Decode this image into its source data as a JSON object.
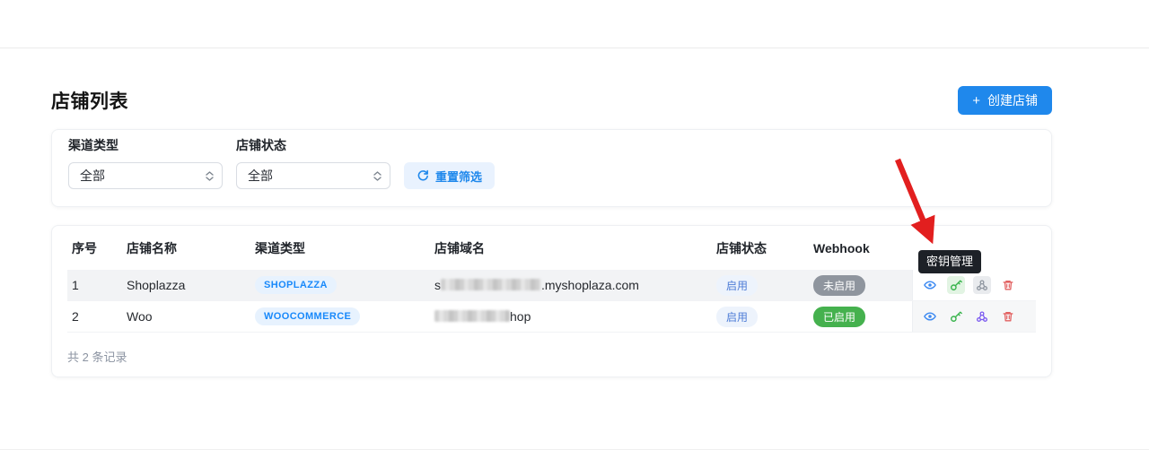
{
  "page": {
    "title": "店铺列表",
    "create_button_label": "创建店铺",
    "records_summary": "共 2 条记录"
  },
  "filters": {
    "channel_type_label": "渠道类型",
    "channel_type_value": "全部",
    "store_status_label": "店铺状态",
    "store_status_value": "全部",
    "reset_label": "重置筛选"
  },
  "table": {
    "headers": {
      "index": "序号",
      "name": "店铺名称",
      "channel": "渠道类型",
      "domain": "店铺域名",
      "status": "店铺状态",
      "webhook": "Webhook",
      "actions": ""
    },
    "rows": [
      {
        "index": "1",
        "name": "Shoplazza",
        "channel_badge": "SHOPLAZZA",
        "domain_visible_prefix": "s",
        "domain_visible_suffix": ".myshoplaza.com",
        "domain_redacted": "yes",
        "store_status": "启用",
        "webhook_status": "未启用"
      },
      {
        "index": "2",
        "name": "Woo",
        "channel_badge": "WOOCOMMERCE",
        "domain_visible_prefix": "",
        "domain_visible_suffix": "hop",
        "domain_redacted": "yes",
        "store_status": "启用",
        "webhook_status": "已启用"
      }
    ]
  },
  "tooltip": {
    "text": "密钥管理"
  },
  "colors": {
    "primary_blue": "#1f88ec",
    "badge_blue": "#1989fa",
    "status_enabled_text": "#4d7cd6",
    "webhook_off_bg": "#8f959e",
    "webhook_on_bg": "#45b14e",
    "icon_view": "#3d8af2",
    "icon_key": "#36b34a",
    "icon_webhook_gray": "#9097a1",
    "icon_webhook_purple": "#7d5cf0",
    "icon_delete": "#e26161",
    "arrow_red": "#e21f1f"
  }
}
